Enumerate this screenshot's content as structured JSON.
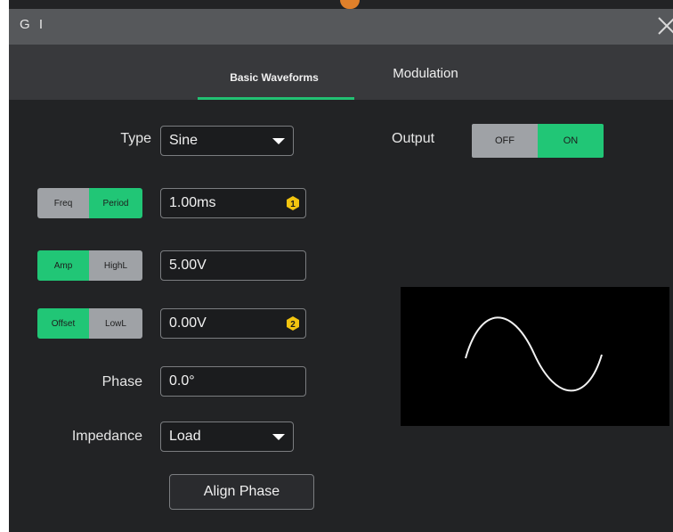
{
  "window": {
    "title": "G I",
    "accent_color": "#22c173"
  },
  "tabs": [
    {
      "label": "Basic Waveforms",
      "active": true
    },
    {
      "label": "Modulation",
      "active": false
    }
  ],
  "form": {
    "type": {
      "label": "Type",
      "value": "Sine"
    },
    "freq_period": {
      "options": [
        "Freq",
        "Period"
      ],
      "selected": "Period",
      "value": "1.00ms",
      "badge": "1"
    },
    "amp_highl": {
      "options": [
        "Amp",
        "HighL"
      ],
      "selected": "Amp",
      "value": "5.00V"
    },
    "offset_lowl": {
      "options": [
        "Offset",
        "LowL"
      ],
      "selected": "Offset",
      "value": "0.00V",
      "badge": "2"
    },
    "phase": {
      "label": "Phase",
      "value": "0.0°"
    },
    "impedance": {
      "label": "Impedance",
      "value": "Load"
    },
    "align_phase_label": "Align Phase"
  },
  "output": {
    "label": "Output",
    "off_label": "OFF",
    "on_label": "ON",
    "state": "ON"
  },
  "preview": {
    "waveform": "sine"
  }
}
